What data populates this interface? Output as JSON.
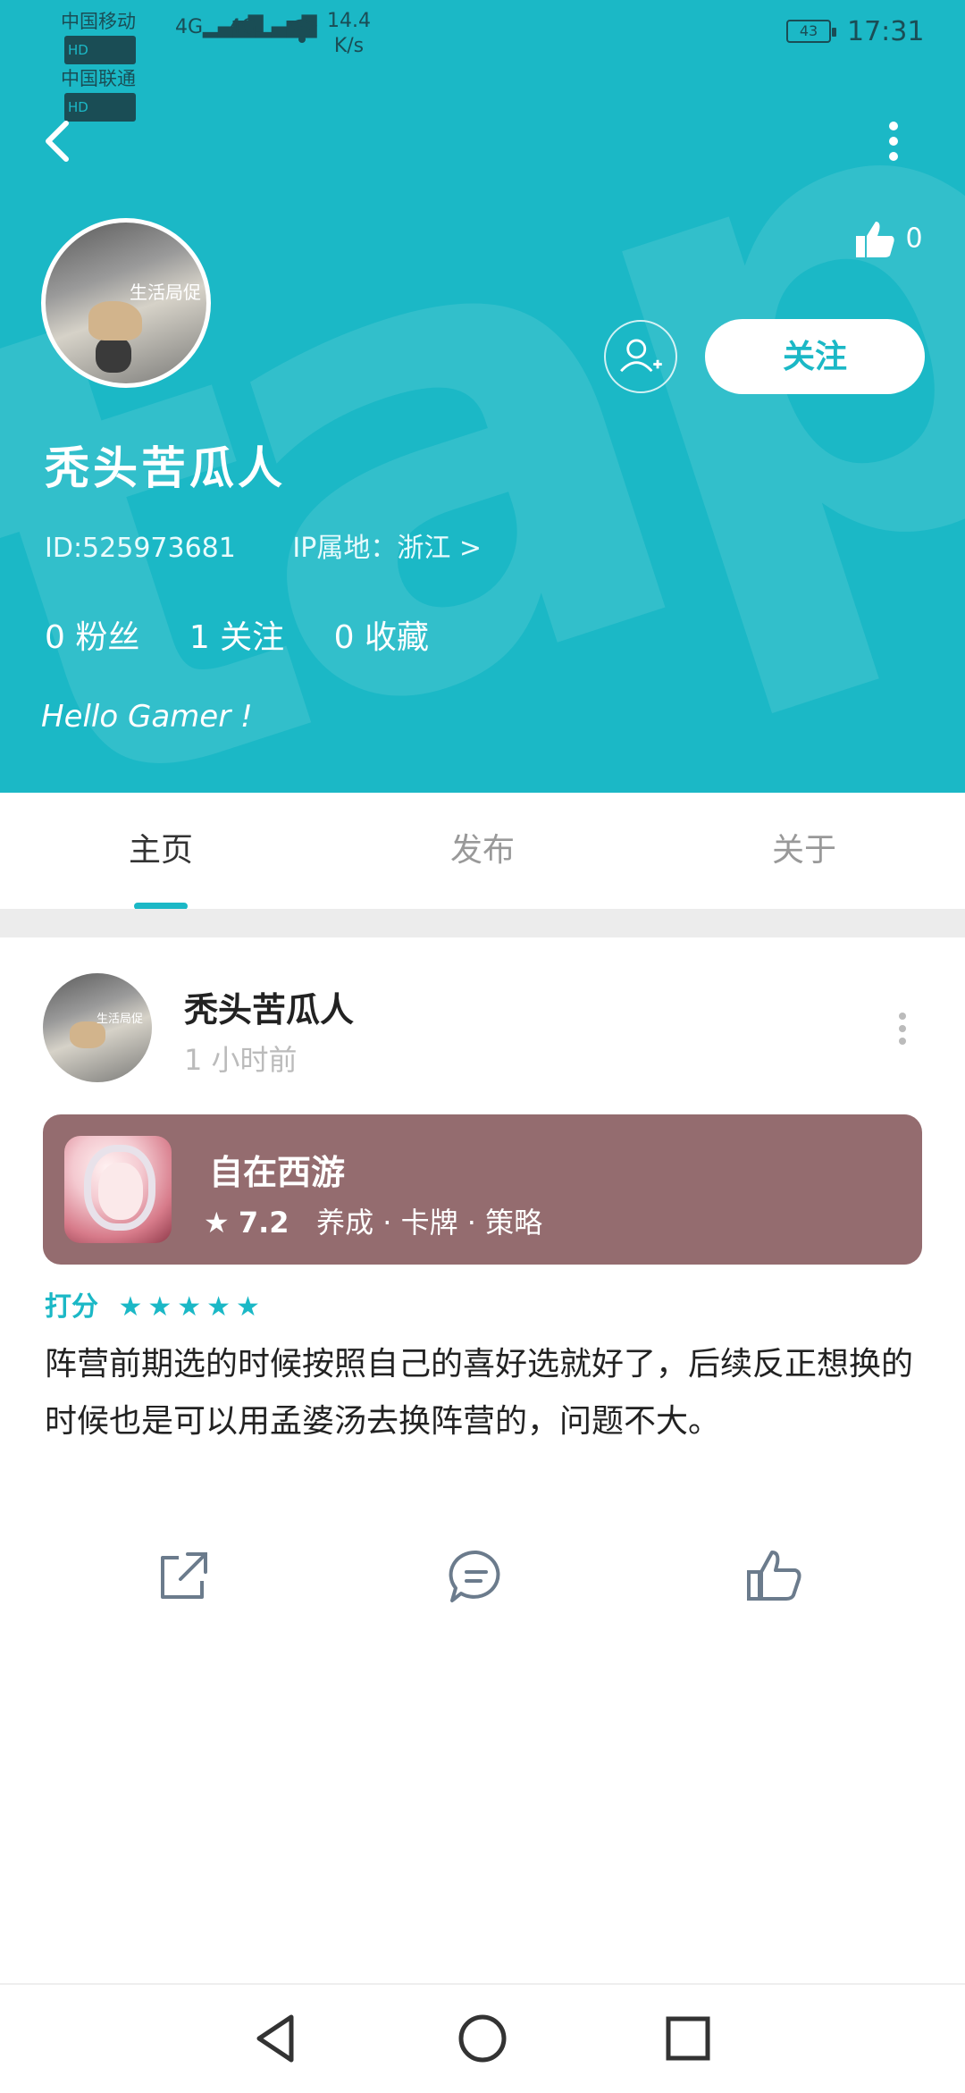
{
  "status_bar": {
    "carrier1": "中国移动",
    "carrier2": "中国联通",
    "hd": "HD",
    "signal1": "4G",
    "signal2": "4G",
    "speed_value": "14.4",
    "speed_unit": "K/s",
    "battery": "43",
    "time": "17:31"
  },
  "header": {
    "likes": "0",
    "follow_label": "关注",
    "username": "秃头苦瓜人",
    "id_text": "ID:525973681",
    "ip_text": "IP属地：浙江 >",
    "stats": [
      "0 粉丝",
      "1 关注",
      "0 收藏"
    ],
    "bio": "Hello Gamer !",
    "avatar_tag": "生活局促"
  },
  "tabs": [
    {
      "label": "主页",
      "active": true
    },
    {
      "label": "发布",
      "active": false
    },
    {
      "label": "关于",
      "active": false
    }
  ],
  "post": {
    "author": "秃头苦瓜人",
    "time": "1 小时前",
    "avatar_tag": "生活局促",
    "game": {
      "title": "自在西游",
      "score": "7.2",
      "tags": "养成 · 卡牌 · 策略"
    },
    "rating_label": "打分",
    "stars": "★★★★★",
    "content": "阵营前期选的时候按照自己的喜好选就好了，后续反正想换的时候也是可以用孟婆汤去换阵营的，问题不大。"
  },
  "colors": {
    "accent": "#1bb8c6",
    "game_card": "#946c6f"
  }
}
